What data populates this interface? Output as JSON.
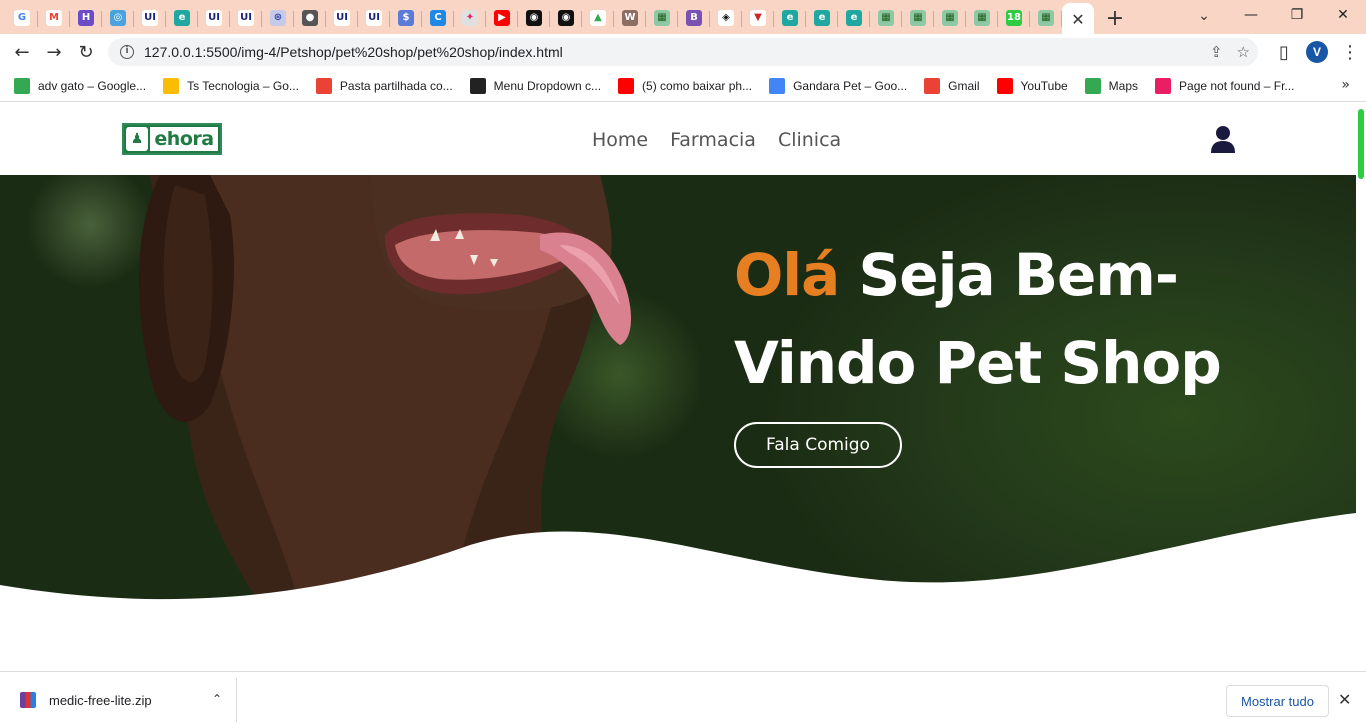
{
  "browser": {
    "tabs": [
      {
        "icon": "google-icon",
        "label": "G",
        "color": "#ffffff",
        "fg": "#4285f4"
      },
      {
        "icon": "gmail-icon",
        "label": "M",
        "color": "#ffffff",
        "fg": "#ea4335"
      },
      {
        "icon": "h-icon",
        "label": "H",
        "color": "#6a4cc9",
        "fg": "#ffffff"
      },
      {
        "icon": "circle-app-icon",
        "label": "◎",
        "color": "#4aa3df",
        "fg": "#ffffff"
      },
      {
        "icon": "ui-icon",
        "label": "UI",
        "color": "#ffffff",
        "fg": "#1a237e"
      },
      {
        "icon": "edge-icon",
        "label": "e",
        "color": "#1fa8a0",
        "fg": "#ffffff"
      },
      {
        "icon": "ui-icon",
        "label": "UI",
        "color": "#ffffff",
        "fg": "#1a237e"
      },
      {
        "icon": "ui-icon",
        "label": "UI",
        "color": "#ffffff",
        "fg": "#1a237e"
      },
      {
        "icon": "grid-icon",
        "label": "⊛",
        "color": "#c5cae9",
        "fg": "#3949ab"
      },
      {
        "icon": "globe-icon",
        "label": "●",
        "color": "#555555",
        "fg": "#ffffff"
      },
      {
        "icon": "ui-icon",
        "label": "UI",
        "color": "#ffffff",
        "fg": "#1a237e"
      },
      {
        "icon": "ui-icon",
        "label": "UI",
        "color": "#ffffff",
        "fg": "#1a237e"
      },
      {
        "icon": "dollar-icon",
        "label": "$",
        "color": "#5c7bd9",
        "fg": "#ffffff"
      },
      {
        "icon": "c-icon",
        "label": "C",
        "color": "#1e88e5",
        "fg": "#ffffff"
      },
      {
        "icon": "colorful-icon",
        "label": "✦",
        "color": "#e0e0e0",
        "fg": "#e91e63"
      },
      {
        "icon": "youtube-icon",
        "label": "▶",
        "color": "#ff0000",
        "fg": "#ffffff"
      },
      {
        "icon": "github-icon",
        "label": "◉",
        "color": "#111111",
        "fg": "#ffffff"
      },
      {
        "icon": "github-icon",
        "label": "◉",
        "color": "#111111",
        "fg": "#ffffff"
      },
      {
        "icon": "drive-icon",
        "label": "▲",
        "color": "#ffffff",
        "fg": "#34a853"
      },
      {
        "icon": "brand-icon",
        "label": "W",
        "color": "#8d6e63",
        "fg": "#ffffff"
      },
      {
        "icon": "spreadsheet-icon",
        "label": "▦",
        "color": "#8fc9a3",
        "fg": "#1b5e20"
      },
      {
        "icon": "bootstrap-icon",
        "label": "B",
        "color": "#7952b3",
        "fg": "#ffffff"
      },
      {
        "icon": "codepen-icon",
        "label": "◈",
        "color": "#ffffff",
        "fg": "#111111"
      },
      {
        "icon": "red-logo-icon",
        "label": "▼",
        "color": "#ffffff",
        "fg": "#c62828"
      },
      {
        "icon": "edge-icon",
        "label": "e",
        "color": "#1fa8a0",
        "fg": "#ffffff"
      },
      {
        "icon": "edge-icon",
        "label": "e",
        "color": "#1fa8a0",
        "fg": "#ffffff"
      },
      {
        "icon": "edge-icon",
        "label": "e",
        "color": "#1fa8a0",
        "fg": "#ffffff"
      },
      {
        "icon": "spreadsheet-icon",
        "label": "▦",
        "color": "#8fc9a3",
        "fg": "#1b5e20"
      },
      {
        "icon": "spreadsheet-icon",
        "label": "▦",
        "color": "#8fc9a3",
        "fg": "#1b5e20"
      },
      {
        "icon": "spreadsheet-icon",
        "label": "▦",
        "color": "#8fc9a3",
        "fg": "#1b5e20"
      },
      {
        "icon": "spreadsheet-icon",
        "label": "▦",
        "color": "#8fc9a3",
        "fg": "#1b5e20"
      },
      {
        "icon": "badge-18-icon",
        "label": "18",
        "color": "#2ecc40",
        "fg": "#ffffff"
      },
      {
        "icon": "spreadsheet-icon",
        "label": "▦",
        "color": "#8fc9a3",
        "fg": "#1b5e20"
      }
    ],
    "active_tab_close": "✕",
    "new_tab": "+",
    "window": {
      "minimize": "—",
      "maximize": "❐",
      "close": "✕",
      "tab_search": "⌄"
    },
    "nav": {
      "back": "←",
      "forward": "→",
      "reload": "↻"
    },
    "url": "127.0.0.1:5500/img-4/Petshop/pet%20shop/pet%20shop/index.html",
    "omnibox_icons": {
      "share": "⇪",
      "star": "☆"
    },
    "profile_initial": "V",
    "sidepanel": "▯",
    "menu": "⋮"
  },
  "bookmarks": [
    {
      "icon": "drive-icon",
      "label": "adv gato – Google...",
      "color": "#34a853"
    },
    {
      "icon": "drive-icon",
      "label": "Ts Tecnologia – Go...",
      "color": "#fbbc04"
    },
    {
      "icon": "gmail-icon",
      "label": "Pasta partilhada co...",
      "color": "#ea4335"
    },
    {
      "icon": "codepen-icon",
      "label": "Menu Dropdown c...",
      "color": "#222222"
    },
    {
      "icon": "youtube-icon",
      "label": "(5) como baixar ph...",
      "color": "#ff0000"
    },
    {
      "icon": "drive-icon",
      "label": "Gandara Pet – Goo...",
      "color": "#4285f4"
    },
    {
      "icon": "gmail-icon",
      "label": "Gmail",
      "color": "#ea4335"
    },
    {
      "icon": "youtube-icon",
      "label": "YouTube",
      "color": "#ff0000"
    },
    {
      "icon": "maps-icon",
      "label": "Maps",
      "color": "#34a853"
    },
    {
      "icon": "colorful-icon",
      "label": "Page not found – Fr...",
      "color": "#e91e63"
    }
  ],
  "bookmarks_more": "»",
  "site": {
    "logo_text": "ehora",
    "logo_glyph": "♟",
    "menu": [
      "Home",
      "Farmacia",
      "Clinica"
    ],
    "hero": {
      "title_accent": "Olá",
      "title_rest": " Seja Bem-Vindo Pet Shop",
      "cta": "Fala Comigo"
    },
    "colors": {
      "accent": "#e67e22",
      "logo_green": "#1f7a44",
      "user_icon": "#1a1a3e"
    }
  },
  "downloads": {
    "file": "medic-free-lite.zip",
    "caret": "⌃",
    "show_all": "Mostrar tudo",
    "close": "✕"
  }
}
